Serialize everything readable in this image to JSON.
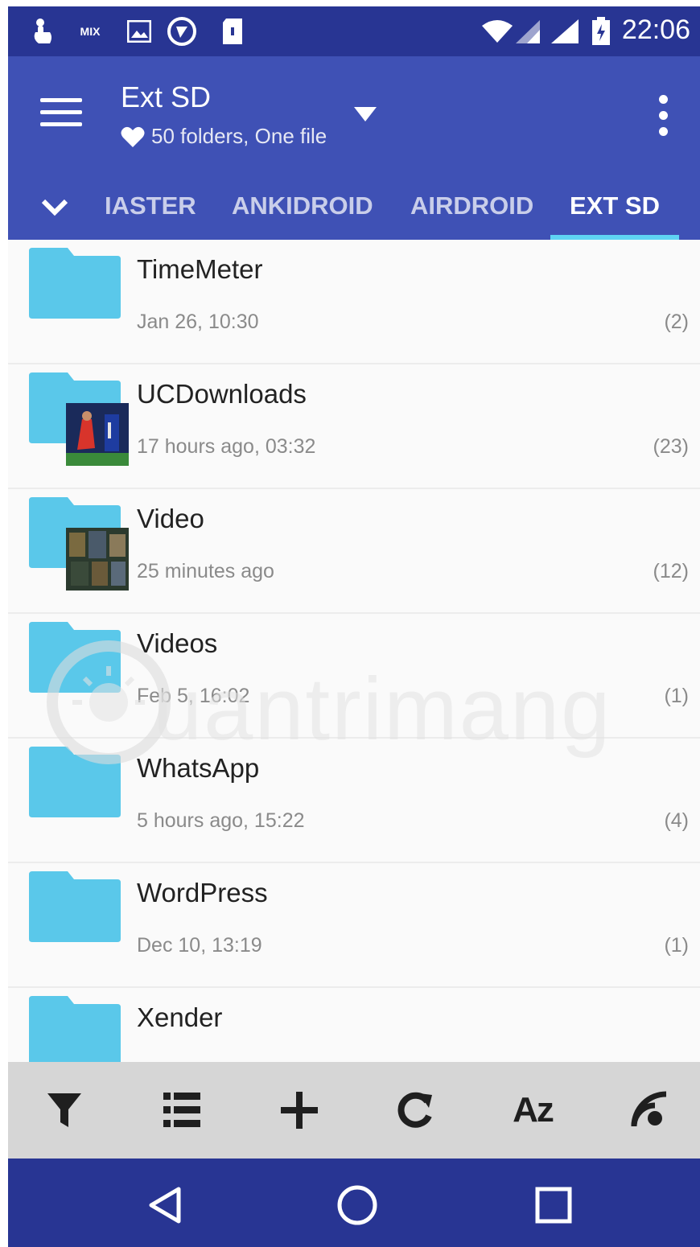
{
  "status_bar": {
    "time": "22:06",
    "mix_label": "MIX"
  },
  "app_bar": {
    "title": "Ext SD",
    "subtitle": "50 folders, One file"
  },
  "tabs": [
    {
      "label": "IASTER",
      "active": false
    },
    {
      "label": "ANKIDROID",
      "active": false
    },
    {
      "label": "AIRDROID",
      "active": false
    },
    {
      "label": "EXT SD",
      "active": true
    }
  ],
  "folders": [
    {
      "name": "TimeMeter",
      "date": "Jan 26, 10:30",
      "count": "(2)",
      "thumbnail": false
    },
    {
      "name": "UCDownloads",
      "date": "17 hours ago, 03:32",
      "count": "(23)",
      "thumbnail": true
    },
    {
      "name": "Video",
      "date": "25 minutes ago",
      "count": "(12)",
      "thumbnail": true
    },
    {
      "name": "Videos",
      "date": "Feb 5, 16:02",
      "count": "(1)",
      "thumbnail": false
    },
    {
      "name": "WhatsApp",
      "date": "5 hours ago, 15:22",
      "count": "(4)",
      "thumbnail": false
    },
    {
      "name": "WordPress",
      "date": "Dec 10, 13:19",
      "count": "(1)",
      "thumbnail": false
    },
    {
      "name": "Xender",
      "date": "",
      "count": "",
      "thumbnail": false
    }
  ],
  "watermark": "uantrimang",
  "toolbar": {
    "sort_label": "Az"
  },
  "colors": {
    "status_bar": "#283593",
    "app_bar": "#3f51b5",
    "tab_indicator": "#5fd3f3",
    "folder": "#5ac8ea",
    "toolbar": "#d6d6d6"
  }
}
